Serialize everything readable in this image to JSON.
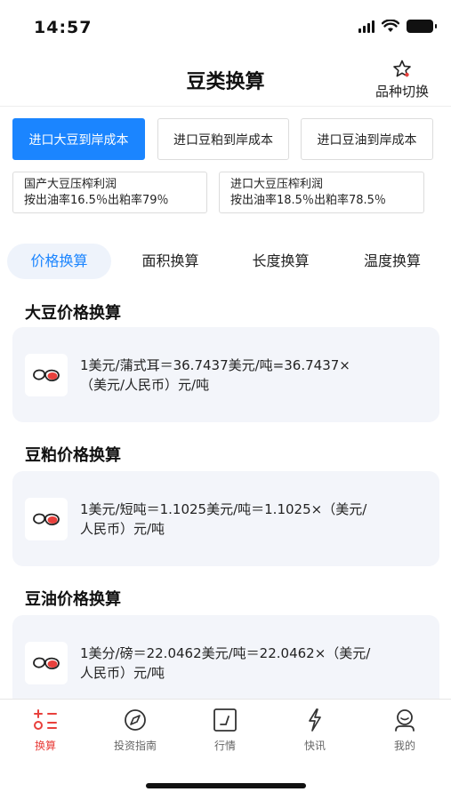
{
  "status_bar": {
    "time": "14:57"
  },
  "header": {
    "title": "豆类换算",
    "switch_label": "品种切换"
  },
  "cost_buttons": [
    {
      "label": "进口大豆到岸成本"
    },
    {
      "label": "进口豆粕到岸成本"
    },
    {
      "label": "进口豆油到岸成本"
    }
  ],
  "profit_cards": [
    {
      "line1": "国产大豆压榨利润",
      "line2": "按出油率16.5％出粕率79％"
    },
    {
      "line1": "进口大豆压榨利润",
      "line2": "按出油率18.5％出粕率78.5％"
    }
  ],
  "tabs": [
    {
      "label": "价格换算"
    },
    {
      "label": "面积换算"
    },
    {
      "label": "长度换算"
    },
    {
      "label": "温度换算"
    }
  ],
  "sections": [
    {
      "title": "大豆价格换算",
      "line1": "1美元/蒲式耳＝36.7437美元/吨=36.7437×",
      "line2": "（美元/人民币）元/吨"
    },
    {
      "title": "豆粕价格换算",
      "line1": "1美元/短吨＝1.1025美元/吨＝1.1025×（美元/",
      "line2": "人民币）元/吨"
    },
    {
      "title": "豆油价格换算",
      "line1": "1美分/磅＝22.0462美元/吨＝22.0462×（美元/",
      "line2": "人民币）元/吨"
    }
  ],
  "bottom_nav": [
    {
      "label": "换算",
      "icon": "calculator-icon"
    },
    {
      "label": "投资指南",
      "icon": "compass-icon"
    },
    {
      "label": "行情",
      "icon": "chart-icon"
    },
    {
      "label": "快讯",
      "icon": "lightning-icon"
    },
    {
      "label": "我的",
      "icon": "profile-icon"
    }
  ],
  "colors": {
    "accent": "#1b85ff",
    "nav_active": "#e8403c",
    "card_bg": "#f3f5fa"
  }
}
